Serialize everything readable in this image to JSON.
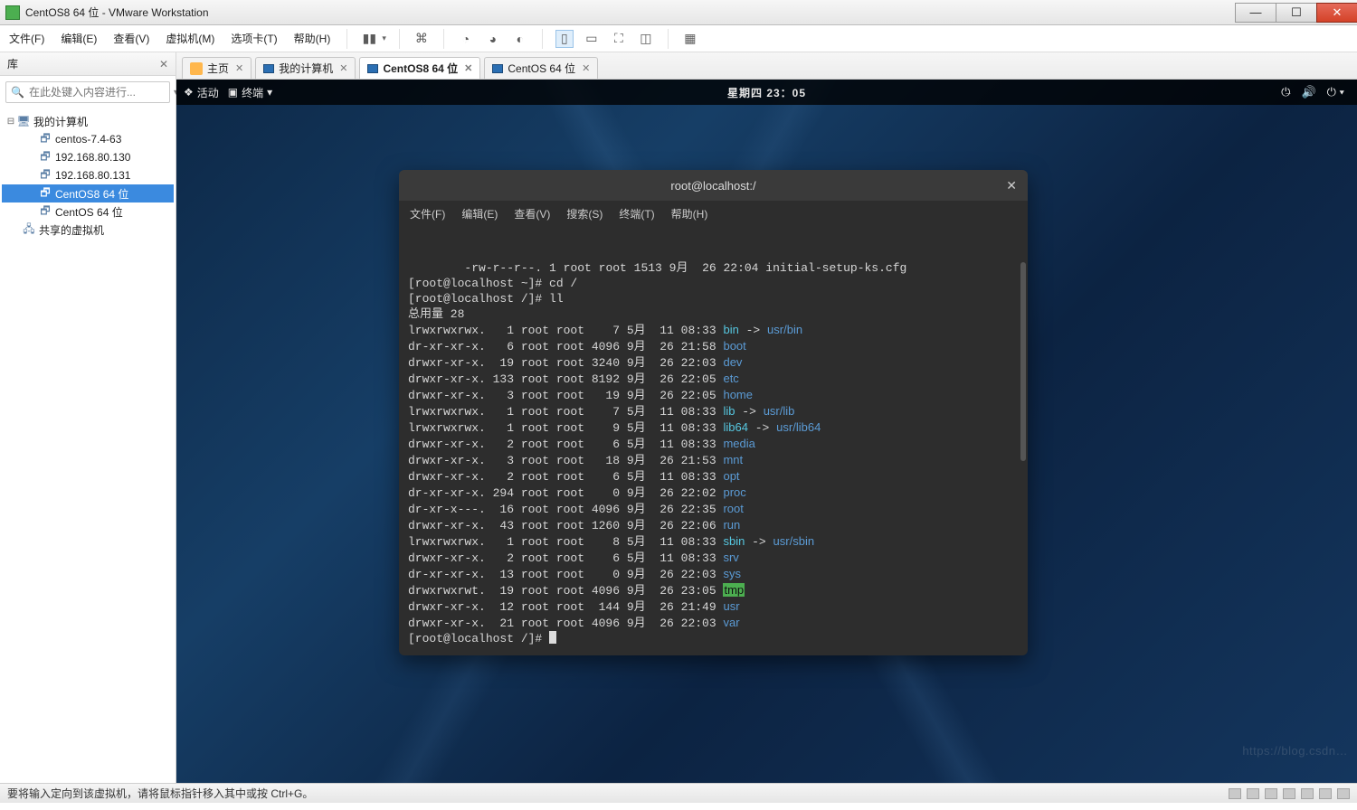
{
  "window": {
    "title": "CentOS8 64 位 - VMware Workstation"
  },
  "menubar": {
    "items": [
      "文件(F)",
      "编辑(E)",
      "查看(V)",
      "虚拟机(M)",
      "选项卡(T)",
      "帮助(H)"
    ]
  },
  "sidebar": {
    "header": "库",
    "search_placeholder": "在此处键入内容进行...",
    "tree": {
      "root": "我的计算机",
      "items": [
        "centos-7.4-63",
        "192.168.80.130",
        "192.168.80.131",
        "CentOS8 64 位",
        "CentOS 64 位"
      ],
      "selected_index": 3,
      "shared": "共享的虚拟机"
    }
  },
  "tabs": {
    "items": [
      "主页",
      "我的计算机",
      "CentOS8 64 位",
      "CentOS 64 位"
    ],
    "active_index": 2
  },
  "gnome": {
    "activities": "活动",
    "terminal_label": "终端",
    "clock": "星期四 23：05"
  },
  "terminal": {
    "title": "root@localhost:/",
    "menu": [
      "文件(F)",
      "编辑(E)",
      "查看(V)",
      "搜索(S)",
      "终端(T)",
      "帮助(H)"
    ],
    "line_file": "-rw-r--r--. 1 root root 1513 9月  26 22:04 initial-setup-ks.cfg",
    "prompt1": "[root@localhost ~]# cd /",
    "prompt2": "[root@localhost /]# ll",
    "total": "总用量 28",
    "rows": [
      {
        "perm": "lrwxrwxrwx.",
        "n": "  1",
        "o": "root root",
        "sz": "   7",
        "d": "5月  11 08:33",
        "name": "bin",
        "link": "usr/bin",
        "cls": "c-cyan"
      },
      {
        "perm": "dr-xr-xr-x.",
        "n": "  6",
        "o": "root root",
        "sz": "4096",
        "d": "9月  26 21:58",
        "name": "boot",
        "cls": "c-blue"
      },
      {
        "perm": "drwxr-xr-x.",
        "n": " 19",
        "o": "root root",
        "sz": "3240",
        "d": "9月  26 22:03",
        "name": "dev",
        "cls": "c-blue"
      },
      {
        "perm": "drwxr-xr-x.",
        "n": "133",
        "o": "root root",
        "sz": "8192",
        "d": "9月  26 22:05",
        "name": "etc",
        "cls": "c-blue"
      },
      {
        "perm": "drwxr-xr-x.",
        "n": "  3",
        "o": "root root",
        "sz": "  19",
        "d": "9月  26 22:05",
        "name": "home",
        "cls": "c-blue"
      },
      {
        "perm": "lrwxrwxrwx.",
        "n": "  1",
        "o": "root root",
        "sz": "   7",
        "d": "5月  11 08:33",
        "name": "lib",
        "link": "usr/lib",
        "cls": "c-cyan"
      },
      {
        "perm": "lrwxrwxrwx.",
        "n": "  1",
        "o": "root root",
        "sz": "   9",
        "d": "5月  11 08:33",
        "name": "lib64",
        "link": "usr/lib64",
        "cls": "c-cyan"
      },
      {
        "perm": "drwxr-xr-x.",
        "n": "  2",
        "o": "root root",
        "sz": "   6",
        "d": "5月  11 08:33",
        "name": "media",
        "cls": "c-blue"
      },
      {
        "perm": "drwxr-xr-x.",
        "n": "  3",
        "o": "root root",
        "sz": "  18",
        "d": "9月  26 21:53",
        "name": "mnt",
        "cls": "c-blue"
      },
      {
        "perm": "drwxr-xr-x.",
        "n": "  2",
        "o": "root root",
        "sz": "   6",
        "d": "5月  11 08:33",
        "name": "opt",
        "cls": "c-blue"
      },
      {
        "perm": "dr-xr-xr-x.",
        "n": "294",
        "o": "root root",
        "sz": "   0",
        "d": "9月  26 22:02",
        "name": "proc",
        "cls": "c-blue"
      },
      {
        "perm": "dr-xr-x---.",
        "n": " 16",
        "o": "root root",
        "sz": "4096",
        "d": "9月  26 22:35",
        "name": "root",
        "cls": "c-blue"
      },
      {
        "perm": "drwxr-xr-x.",
        "n": " 43",
        "o": "root root",
        "sz": "1260",
        "d": "9月  26 22:06",
        "name": "run",
        "cls": "c-blue"
      },
      {
        "perm": "lrwxrwxrwx.",
        "n": "  1",
        "o": "root root",
        "sz": "   8",
        "d": "5月  11 08:33",
        "name": "sbin",
        "link": "usr/sbin",
        "cls": "c-cyan"
      },
      {
        "perm": "drwxr-xr-x.",
        "n": "  2",
        "o": "root root",
        "sz": "   6",
        "d": "5月  11 08:33",
        "name": "srv",
        "cls": "c-blue"
      },
      {
        "perm": "dr-xr-xr-x.",
        "n": " 13",
        "o": "root root",
        "sz": "   0",
        "d": "9月  26 22:03",
        "name": "sys",
        "cls": "c-blue"
      },
      {
        "perm": "drwxrwxrwt.",
        "n": " 19",
        "o": "root root",
        "sz": "4096",
        "d": "9月  26 23:05",
        "name": "tmp",
        "cls": "hl-green"
      },
      {
        "perm": "drwxr-xr-x.",
        "n": " 12",
        "o": "root root",
        "sz": " 144",
        "d": "9月  26 21:49",
        "name": "usr",
        "cls": "c-blue"
      },
      {
        "perm": "drwxr-xr-x.",
        "n": " 21",
        "o": "root root",
        "sz": "4096",
        "d": "9月  26 22:03",
        "name": "var",
        "cls": "c-blue"
      }
    ],
    "prompt3": "[root@localhost /]# "
  },
  "statusbar": {
    "text": "要将输入定向到该虚拟机，请将鼠标指针移入其中或按 Ctrl+G。"
  }
}
